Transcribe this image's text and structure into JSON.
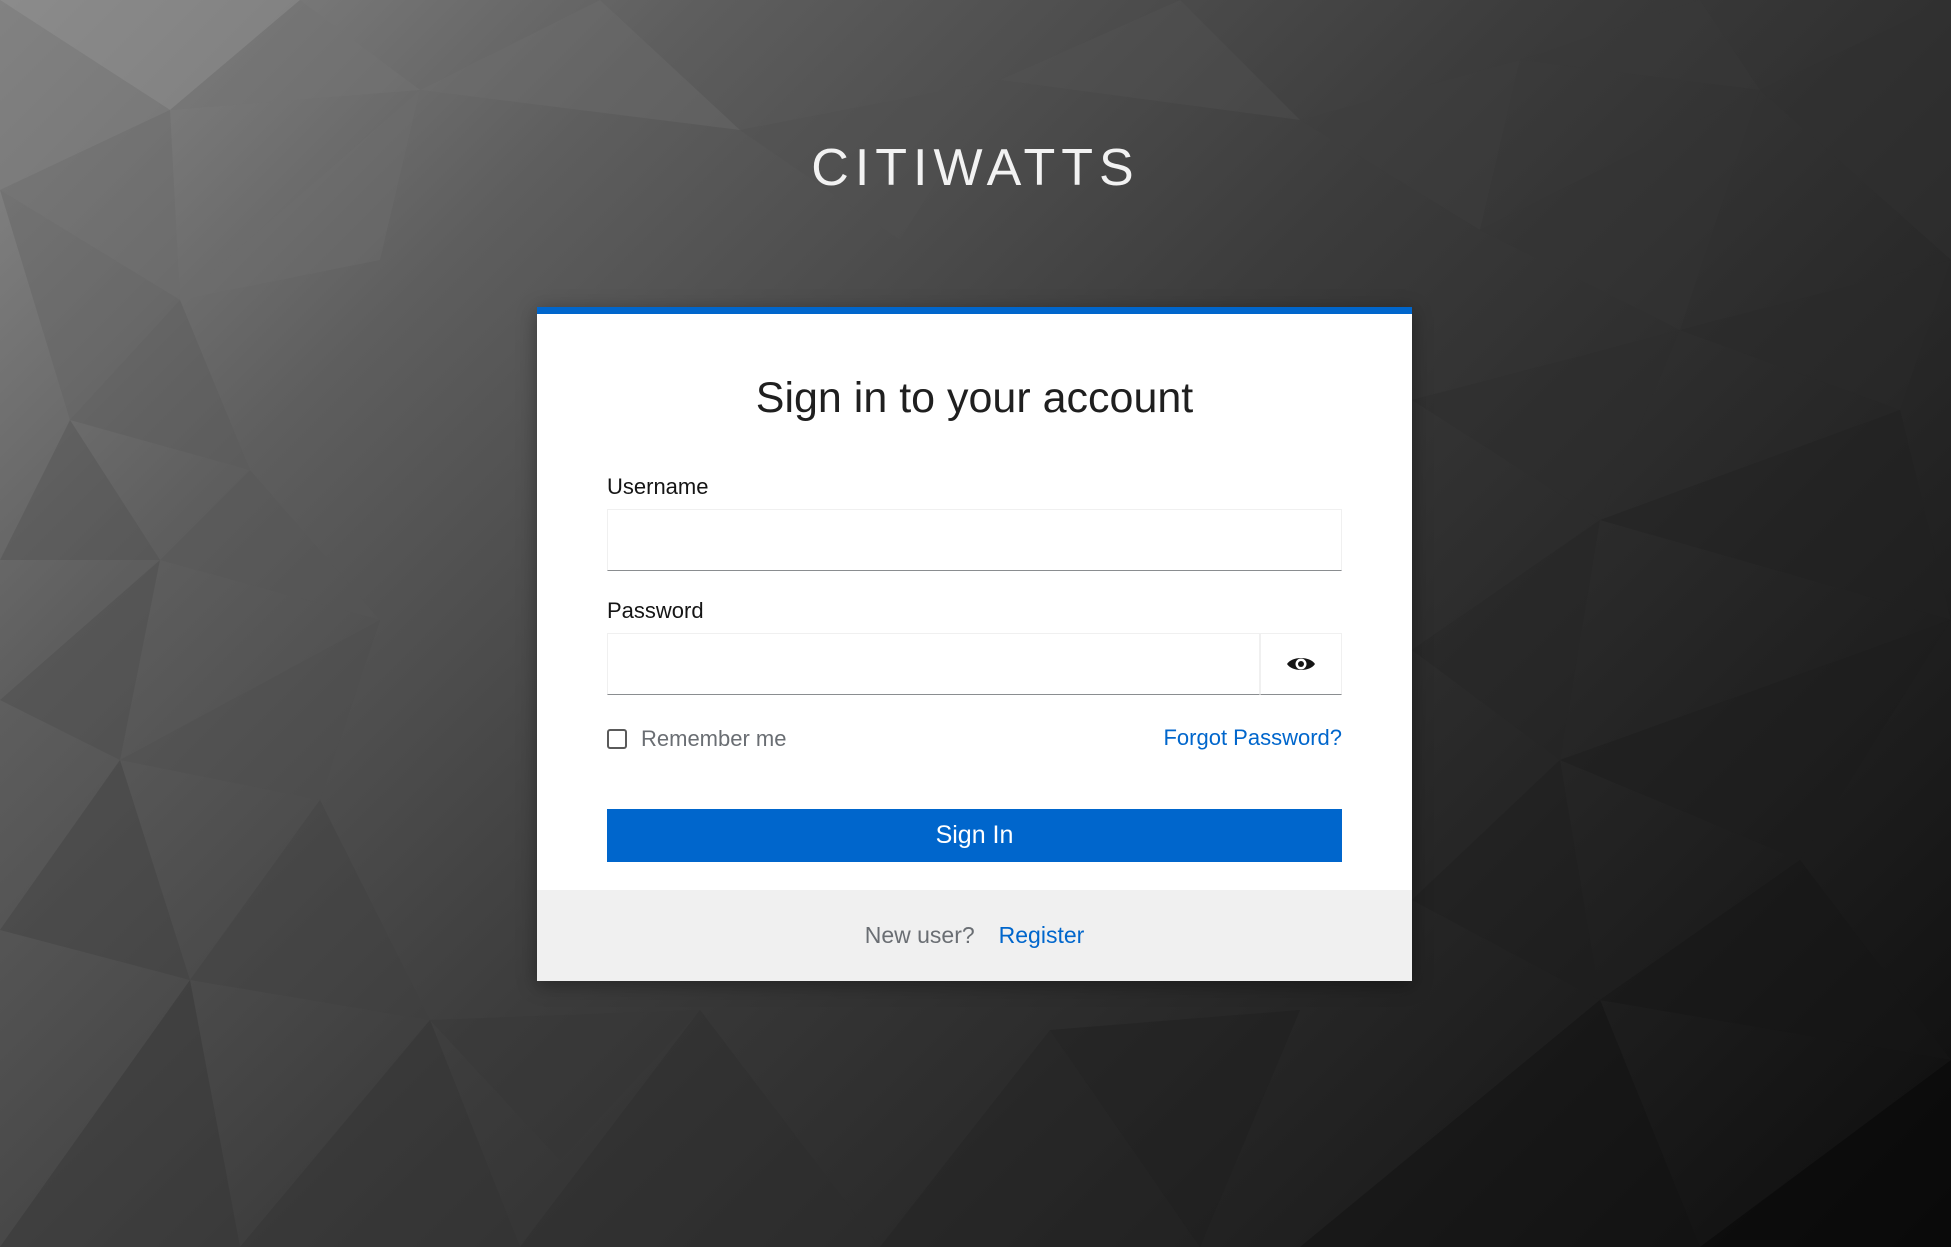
{
  "brand": {
    "title": "CITIWATTS"
  },
  "login": {
    "heading": "Sign in to your account",
    "username_label": "Username",
    "username_value": "",
    "password_label": "Password",
    "password_value": "",
    "show_password_icon": "eye-icon",
    "remember_me_label": "Remember me",
    "remember_me_checked": false,
    "forgot_password_link": "Forgot Password?",
    "sign_in_button": "Sign In"
  },
  "footer": {
    "new_user_text": "New user?",
    "register_link": "Register"
  },
  "colors": {
    "accent": "#0066cc",
    "card_background": "#ffffff",
    "footer_background": "#f0f0f0"
  }
}
